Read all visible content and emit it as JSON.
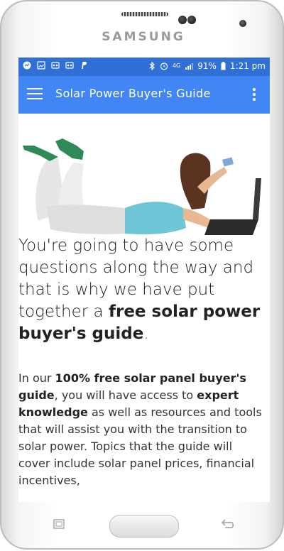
{
  "device": {
    "brand": "SAMSUNG"
  },
  "statusbar": {
    "left_icons": [
      "messenger-icon",
      "gallery-icon",
      "voicemail-icon",
      "voicemail-icon",
      "paypal-icon"
    ],
    "right_icons": [
      "bluetooth-icon",
      "alarm-icon",
      "4g-icon",
      "signal-icon"
    ],
    "battery": "91%",
    "time": "1:21 pm"
  },
  "toolbar": {
    "title": "Solar Power Buyer's Guide",
    "menu_icon": "hamburger-menu-icon",
    "overflow_icon": "more-vert-icon",
    "color": "#4285f4",
    "statusbar_color": "#2f6fd6"
  },
  "hero": {
    "description_icon": "woman-with-laptop-and-card"
  },
  "headline": {
    "part1": "You're going to have some questions along the way and that is why we have put together a ",
    "bold": "free solar power buyer's guide",
    "end": "."
  },
  "body": {
    "t1": "In our ",
    "b1": "100% free solar panel buyer's guide",
    "t2": ", you will have access to ",
    "b2": "expert knowledge",
    "t3": " as well as resources and tools that will assist you with the transition to solar power. Topics that the guide will cover include solar panel prices, financial incentives,"
  }
}
